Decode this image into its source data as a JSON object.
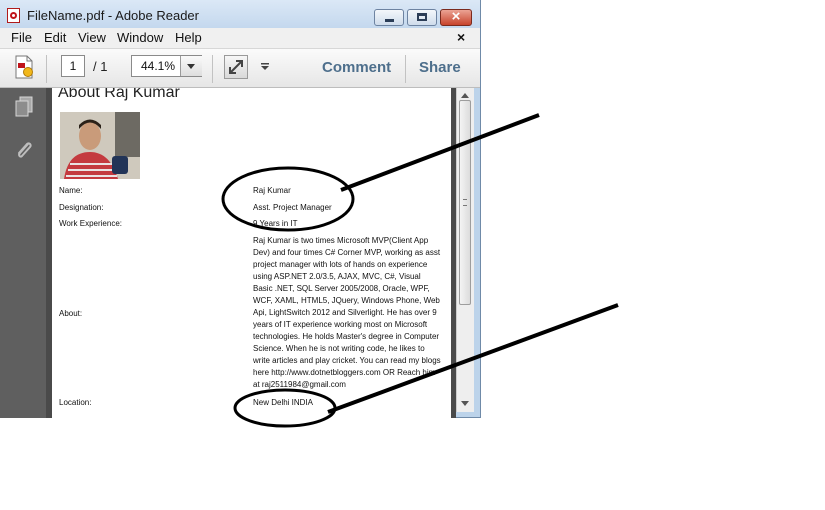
{
  "window": {
    "title": "FileName.pdf - Adobe Reader"
  },
  "menubar": {
    "items": [
      "File",
      "Edit",
      "View",
      "Window",
      "Help"
    ],
    "close": "×"
  },
  "toolbar": {
    "page_current": "1",
    "page_total": "/ 1",
    "zoom": "44.1%",
    "comment_label": "Comment",
    "share_label": "Share"
  },
  "document": {
    "title": "About Raj Kumar",
    "fields": {
      "name_label": "Name:",
      "name_value": "Raj Kumar",
      "designation_label": "Designation:",
      "designation_value": "Asst. Project Manager",
      "experience_label": "Work Experience:",
      "experience_value": "9 Years in IT",
      "about_label": "About:",
      "about_lines": [
        "Raj Kumar is two times Microsoft MVP(Client App",
        "Dev) and four times C# Corner MVP, working as asst",
        "project manager with lots of hands on experience",
        "using ASP.NET 2.0/3.5, AJAX, MVC, C#, Visual",
        "Basic .NET, SQL Server 2005/2008, Oracle, WPF,",
        "WCF, XAML, HTML5, JQuery, Windows Phone, Web",
        "Api, LightSwitch 2012 and Silverlight. He has over 9",
        "years of IT experience working most on Microsoft",
        "technologies. He holds Master's degree in Computer",
        "Science. When he is not writing code, he likes to",
        "write articles and play cricket. You can read my blogs",
        "here http://www.dotnetbloggers.com OR Reach him",
        "at raj2511984@gmail.com"
      ],
      "location_label": "Location:",
      "location_value": "New Delhi INDIA"
    }
  },
  "colors": {
    "title_bar": "#c4d8ee",
    "toolbar_link": "#4e6f8c",
    "sidebar": "#5f5f5f",
    "doc_background": "#4a4a4a",
    "annotation": "#000000"
  }
}
